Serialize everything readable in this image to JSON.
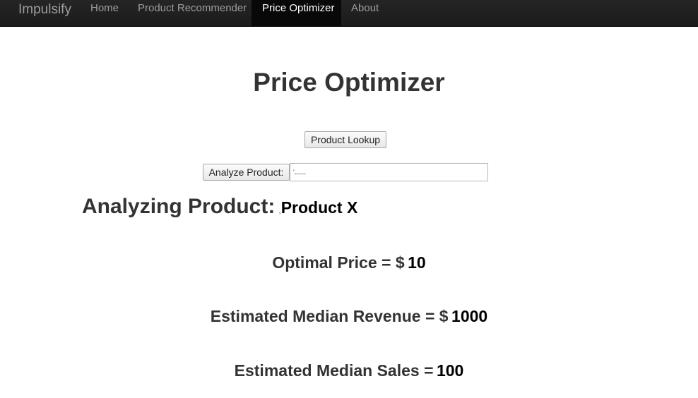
{
  "navbar": {
    "brand": "Impulsify",
    "items": [
      {
        "label": "Home"
      },
      {
        "label": "Product Recommender"
      },
      {
        "label": "Price Optimizer",
        "active": true
      },
      {
        "label": "About"
      }
    ]
  },
  "main": {
    "title": "Price Optimizer",
    "lookup_button": "Product Lookup",
    "analyze_button": "Analyze Product:",
    "product_input_value": "'...........",
    "analyzing_label": "Analyzing Product:",
    "analyzing_separator": ",",
    "analyzing_value": "Product X",
    "metrics": [
      {
        "label": "Optimal Price = $",
        "value": "10"
      },
      {
        "label": "Estimated Median Revenue = $",
        "value": "1000"
      },
      {
        "label": "Estimated Median Sales =",
        "value": "100"
      }
    ]
  },
  "colors": {
    "navbar_bg": "#222222",
    "nav_active_bg": "#080808",
    "nav_text": "#9d9d9d",
    "heading_text": "#333333",
    "value_text": "#000000"
  }
}
